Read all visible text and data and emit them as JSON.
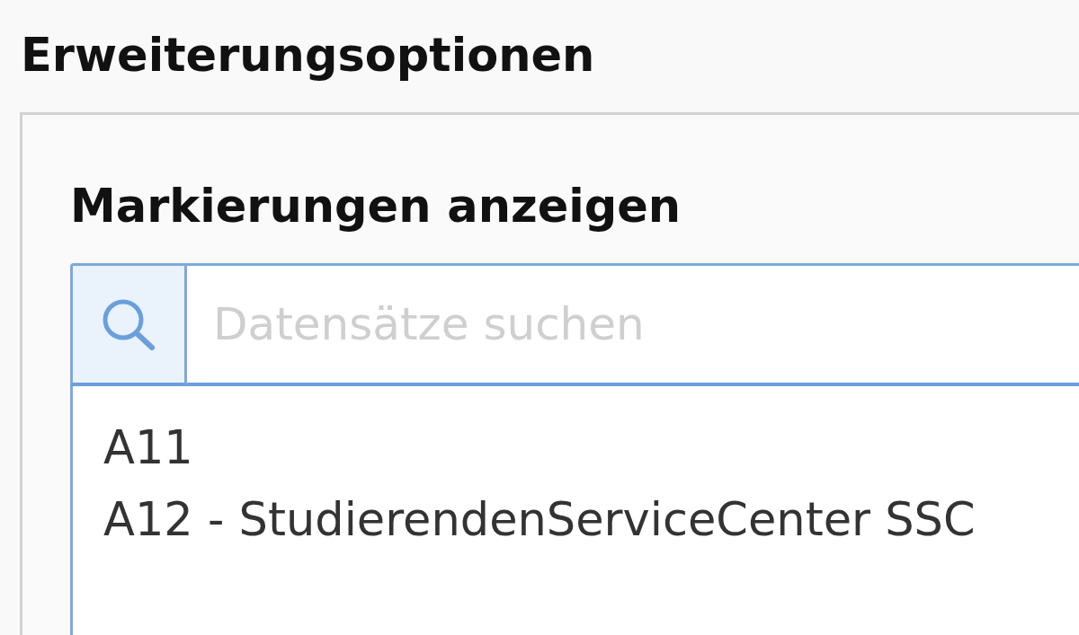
{
  "section_title": "Erweiterungsoptionen",
  "panel": {
    "label": "Markierungen anzeigen",
    "search": {
      "placeholder": "Datensätze suchen"
    },
    "items": [
      "A11",
      "A12 - StudierendenServiceCenter SSC"
    ]
  }
}
